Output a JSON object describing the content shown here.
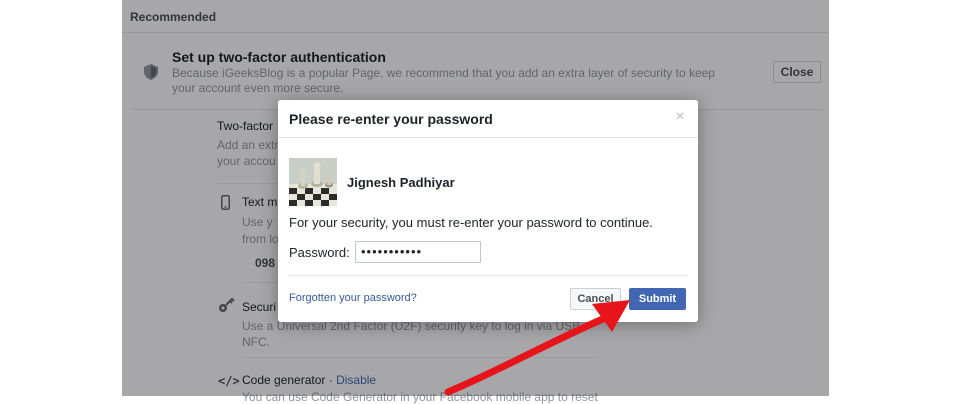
{
  "background": {
    "recommended_header": "Recommended",
    "recommendation": {
      "title": "Set up two-factor authentication",
      "description": "Because iGeeksBlog is a popular Page, we recommend that you add an extra layer of security to keep your account even more secure.",
      "close_label": "Close"
    },
    "two_factor": {
      "heading": "Two-factor",
      "description": "Add an extra your accou"
    },
    "text_message": {
      "label": "Text m",
      "description": "Use y from lo",
      "phone_number": "098"
    },
    "security_key": {
      "label": "Securi",
      "description": "Use a Universal 2nd Factor (U2F) security key to log in via USB NFC."
    },
    "code_generator": {
      "icon_text": "</>",
      "label": "Code generator · ",
      "disable_label": "Disable",
      "description": "You can use Code Generator in your Facebook mobile app to reset"
    }
  },
  "dialog": {
    "title": "Please re-enter your password",
    "close_glyph": "×",
    "user_name": "Jignesh Padhiyar",
    "message": "For your security, you must re-enter your password to continue.",
    "password_label": "Password:",
    "password_value": "•••••••••••",
    "forgot_link": "Forgotten your password?",
    "cancel_label": "Cancel",
    "submit_label": "Submit"
  },
  "icons": {
    "shield": "shield-icon",
    "phone": "phone-icon",
    "key": "key-icon",
    "code": "code-icon",
    "close": "close-icon",
    "arrow": "arrow-annotation"
  },
  "colors": {
    "brand_blue": "#4267b2",
    "link_blue": "#365899",
    "annotation_red": "#e8141b"
  }
}
